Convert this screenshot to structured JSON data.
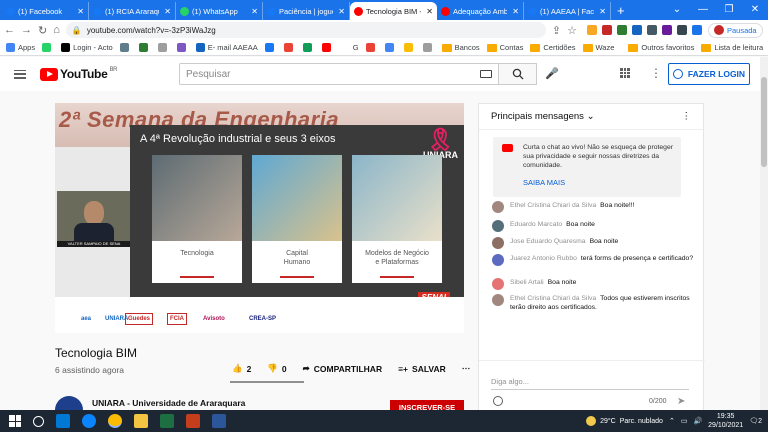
{
  "browser": {
    "tabs": [
      {
        "label": "(1) Facebook",
        "color": "#1877f2",
        "active": false
      },
      {
        "label": "(1) RCIA Araraquar",
        "color": "#1877f2",
        "active": false
      },
      {
        "label": "(1) WhatsApp",
        "color": "#25d366",
        "active": false
      },
      {
        "label": "Paciência | jogue",
        "color": "#1877f2",
        "active": false
      },
      {
        "label": "Tecnologia BIM -",
        "color": "#ff0000",
        "active": true
      },
      {
        "label": "Adequação Amb",
        "color": "#ff0000",
        "active": false
      },
      {
        "label": "(1) AAEAA | Faceb",
        "color": "#1877f2",
        "active": false
      }
    ],
    "new_tab": "+",
    "address": "youtube.com/watch?v=-3zP3iWaJzg",
    "profile_label": "Pausada",
    "bookmarks": [
      {
        "label": "Apps",
        "color": "#4285f4"
      },
      {
        "label": "",
        "color": "#25d366"
      },
      {
        "label": "Login - Acto",
        "color": "#000000"
      },
      {
        "label": "",
        "color": "#607d8b"
      },
      {
        "label": "",
        "color": "#2e7d32"
      },
      {
        "label": "",
        "color": "#9e9e9e"
      },
      {
        "label": "",
        "color": "#7e57c2"
      },
      {
        "label": "E- mail AAEAA",
        "color": "#1565c0"
      },
      {
        "label": "",
        "color": "#1877f2"
      },
      {
        "label": "",
        "color": "#ea4335"
      },
      {
        "label": "",
        "color": "#0f9d58"
      },
      {
        "label": "",
        "color": "#ff0000"
      },
      {
        "label": "G",
        "color": "#ffffff"
      },
      {
        "label": "",
        "color": "#ea4335"
      },
      {
        "label": "",
        "color": "#4285f4"
      },
      {
        "label": "",
        "color": "#fbbc04"
      },
      {
        "label": "",
        "color": "#9e9e9e"
      }
    ],
    "bookmark_folders": [
      "Bancos",
      "Contas",
      "Certidões",
      "Waze"
    ],
    "other_bookmarks": "Outros favoritos",
    "reading_list": "Lista de leitura"
  },
  "youtube": {
    "logo_text": "YouTube",
    "logo_region": "BR",
    "search_placeholder": "Pesquisar",
    "login_label": "FAZER LOGIN"
  },
  "video": {
    "slide_banner": "2ª Semana da Engenharia",
    "slide_title": "A 4ª Revolução industrial e seus 3 eixos",
    "brand": "UNIARA",
    "cards": [
      "Tecnologia",
      "Capital\nHumano",
      "Modelos de Negócio\ne Plataformas"
    ],
    "webcam_caption": "VALTER SAMPAIO DE SENA",
    "sponsor_logos": [
      "aea",
      "UNIARA",
      "Guedes",
      "FCIA",
      "Avisoto",
      "CREA-SP"
    ],
    "senai": "SENAI",
    "title": "Tecnologia BIM",
    "watching": "6 assistindo agora",
    "likes": "2",
    "dislikes": "0",
    "share_label": "COMPARTILHAR",
    "save_label": "SALVAR",
    "channel": "UNIARA - Universidade de Araraquara",
    "subscribe_label": "INSCREVER-SE"
  },
  "chat": {
    "header": "Principais mensagens",
    "pinned_text": "Curta o chat ao vivo! Não se esqueça de proteger sua privacidade e seguir nossas diretrizes da comunidade.",
    "pinned_link": "SAIBA MAIS",
    "messages": [
      {
        "author": "Ethel Cristina Chiari da Silva",
        "text": "Boa noite!!!",
        "color": "#a1887f"
      },
      {
        "author": "Eduardo Marcato",
        "text": "Boa noite",
        "color": "#546e7a"
      },
      {
        "author": "Jose Eduardo Quaresma",
        "text": "Boa noite",
        "color": "#8d6e63"
      },
      {
        "author": "Juarez Antonio Rubbo",
        "text": "terá forms de presença e certificado?",
        "color": "#5c6bc0",
        "initial": "J"
      },
      {
        "author": "Sibeli Artali",
        "text": "Boa noite",
        "color": "#e57373"
      },
      {
        "author": "Ethel Cristina Chiari da Silva",
        "text": "Todos que estiverem inscritos terão direito aos certificados.",
        "color": "#a1887f"
      }
    ],
    "input_placeholder": "Diga algo...",
    "char_count": "0/200"
  },
  "taskbar": {
    "weather_temp": "29°C",
    "weather_desc": "Parc. nublado",
    "time": "19:35",
    "date": "29/10/2021",
    "notifications": "2"
  }
}
